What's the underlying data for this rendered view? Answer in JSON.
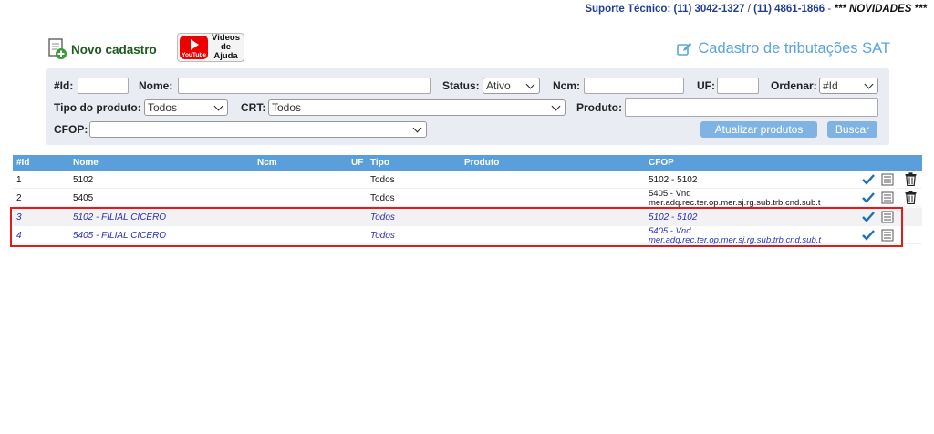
{
  "support": {
    "label": "Suporte Técnico:",
    "phone1": "(11) 3042-1327",
    "slash": "/",
    "phone2": "(11) 4861-1866",
    "dash": "-",
    "novidades": "*** NOVIDADES ***"
  },
  "toolbar": {
    "new_label": "Novo cadastro",
    "video_brand": "YouTube",
    "video_label_line1": "Videos",
    "video_label_line2": "de Ajuda",
    "page_title": "Cadastro de tributações SAT"
  },
  "filters": {
    "id_label": "#Id:",
    "nome_label": "Nome:",
    "status_label": "Status:",
    "status_value": "Ativo",
    "ncm_label": "Ncm:",
    "uf_label": "UF:",
    "ordenar_label": "Ordenar:",
    "ordenar_value": "#Id",
    "tipo_label": "Tipo do produto:",
    "tipo_value": "Todos",
    "crt_label": "CRT:",
    "crt_value": "Todos",
    "produto_label": "Produto:",
    "cfop_label": "CFOP:",
    "cfop_value": "",
    "update_button": "Atualizar produtos",
    "search_button": "Buscar"
  },
  "grid": {
    "columns": [
      "#Id",
      "Nome",
      "Ncm",
      "UF",
      "Tipo",
      "Produto",
      "CFOP"
    ],
    "rows": [
      {
        "id": "1",
        "nome": "5102",
        "ncm": "",
        "uf": "",
        "tipo": "Todos",
        "produto": "",
        "cfop_line1": "5102 - 5102",
        "cfop_line2": ""
      },
      {
        "id": "2",
        "nome": "5405",
        "ncm": "",
        "uf": "",
        "tipo": "Todos",
        "produto": "",
        "cfop_line1": "5405 - Vnd",
        "cfop_line2": "mer.adq.rec.ter.op.mer.sj.rg.sub.trb.cnd.sub.t"
      },
      {
        "id": "3",
        "nome": "5102 - FILIAL CICERO",
        "ncm": "",
        "uf": "",
        "tipo": "Todos",
        "produto": "",
        "cfop_line1": "5102 - 5102",
        "cfop_line2": ""
      },
      {
        "id": "4",
        "nome": "5405 - FILIAL CICERO",
        "ncm": "",
        "uf": "",
        "tipo": "Todos",
        "produto": "",
        "cfop_line1": "5405 - Vnd",
        "cfop_line2": "mer.adq.rec.ter.op.mer.sj.rg.sub.trb.cnd.sub.t"
      }
    ]
  },
  "colors": {
    "accent": "#5a9fd9",
    "title": "#5aa5dc",
    "highlight_text": "#2a2fb8",
    "highlight_frame": "#e01b1b",
    "check": "#1f6fb5"
  }
}
